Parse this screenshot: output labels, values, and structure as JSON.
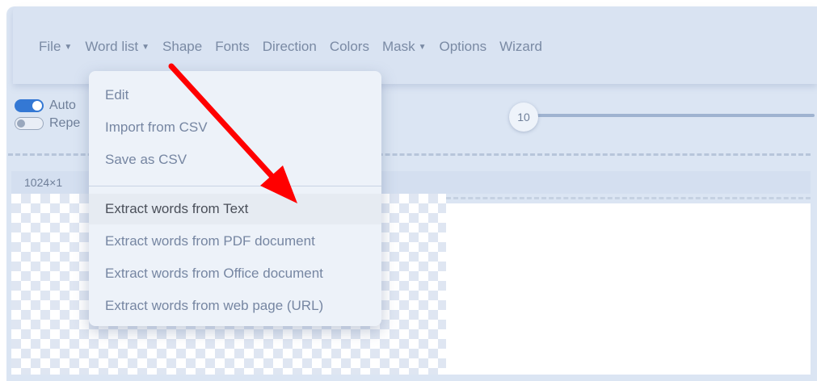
{
  "menubar": {
    "items": [
      {
        "label": "File",
        "has_caret": true
      },
      {
        "label": "Word list",
        "has_caret": true
      },
      {
        "label": "Shape",
        "has_caret": false
      },
      {
        "label": "Fonts",
        "has_caret": false
      },
      {
        "label": "Direction",
        "has_caret": false
      },
      {
        "label": "Colors",
        "has_caret": false
      },
      {
        "label": "Mask",
        "has_caret": true
      },
      {
        "label": "Options",
        "has_caret": false
      },
      {
        "label": "Wizard",
        "has_caret": false
      }
    ]
  },
  "toggles": {
    "auto_label": "Auto",
    "repeat_label": "Repe",
    "auto_on": true,
    "repeat_on": false
  },
  "slider": {
    "value": "10"
  },
  "canvas": {
    "size_label": "1024×1"
  },
  "dropdown": {
    "group1": [
      "Edit",
      "Import from CSV",
      "Save as CSV"
    ],
    "group2": [
      "Extract words from Text",
      "Extract words from PDF document",
      "Extract words from Office document",
      "Extract words from web page (URL)"
    ],
    "highlighted_index": 0
  },
  "colors": {
    "accent": "#3478d4",
    "annotation_arrow": "#ff0000"
  }
}
